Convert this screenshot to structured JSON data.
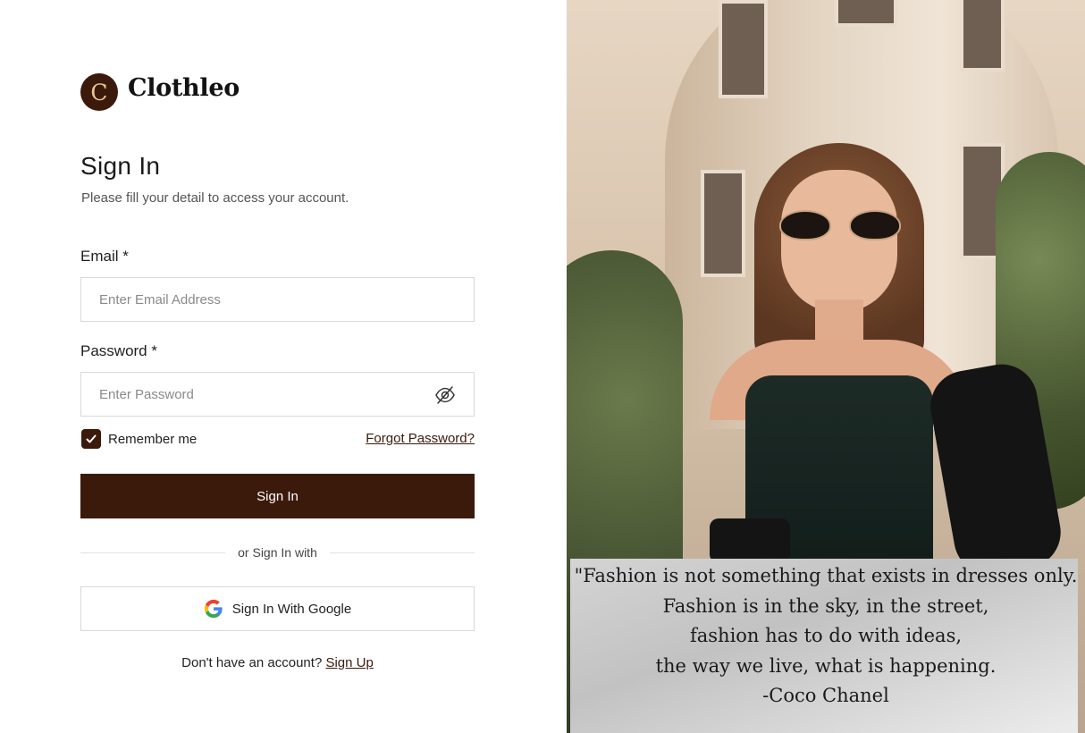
{
  "brand": {
    "logo_letter": "C",
    "name": "Clothleo"
  },
  "form": {
    "title": "Sign In",
    "subtitle": "Please fill your detail to access your account.",
    "email_label": "Email *",
    "email_placeholder": "Enter Email Address",
    "email_value": "",
    "password_label": "Password *",
    "password_placeholder": "Enter Password",
    "password_value": "",
    "remember_label": "Remember me",
    "remember_checked": true,
    "forgot_label": "Forgot Password?",
    "signin_label": "Sign In",
    "divider_label": "or Sign In with",
    "google_label": "Sign In With Google",
    "no_account_text": "Don't have an account?",
    "signup_label": "Sign Up"
  },
  "quote": {
    "lines": [
      "\"Fashion is not something that exists in dresses only.",
      "Fashion is in the sky, in the street,",
      "fashion has to do with ideas,",
      "the way we live, what is happening.",
      "-Coco Chanel"
    ]
  },
  "colors": {
    "accent": "#3b1a0c",
    "logo_letter": "#e9c48f",
    "border": "#d9d9d9"
  },
  "icons": {
    "password_toggle": "eye-off-icon",
    "google": "google-icon",
    "checkbox": "check-icon"
  }
}
